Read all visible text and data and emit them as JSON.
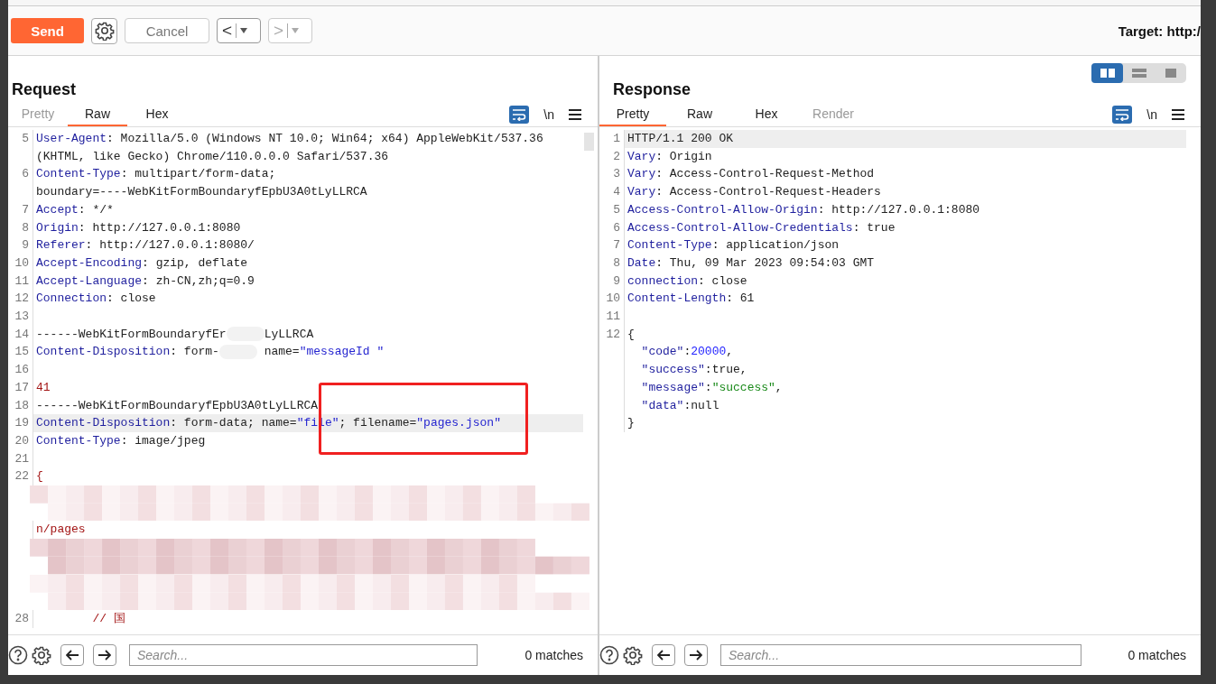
{
  "toolbar": {
    "send": "Send",
    "cancel": "Cancel",
    "back": "<",
    "forward": ">",
    "target": "Target: http:/"
  },
  "request": {
    "title": "Request",
    "tabs": [
      {
        "label": "Pretty",
        "selected": false,
        "disabled": true
      },
      {
        "label": "Raw",
        "selected": true,
        "disabled": false
      },
      {
        "label": "Hex",
        "selected": false,
        "disabled": false
      }
    ],
    "wrap_on": true,
    "newline_label": "\\n",
    "lines": [
      {
        "kind": "code",
        "number": "5",
        "highlighted": false,
        "rows": [
          {
            "parts": [
              {
                "kind": "key",
                "text": "User-Agent"
              },
              {
                "kind": "plain",
                "text": ": Mozilla/5.0 (Windows NT 10.0; Win64; x64) AppleWebKit/537.36"
              }
            ]
          },
          {
            "parts": [
              {
                "kind": "plain",
                "text": "(KHTML, like Gecko) Chrome/110.0.0.0 Safari/537.36"
              }
            ]
          }
        ]
      },
      {
        "kind": "code",
        "number": "6",
        "highlighted": false,
        "rows": [
          {
            "parts": [
              {
                "kind": "key",
                "text": "Content-Type"
              },
              {
                "kind": "plain",
                "text": ": multipart/form-data;"
              }
            ]
          },
          {
            "parts": [
              {
                "kind": "plain",
                "text": "boundary=----WebKitFormBoundaryfEpbU3A0tLyLLRCA"
              }
            ]
          }
        ]
      },
      {
        "kind": "code",
        "number": "7",
        "highlighted": false,
        "rows": [
          {
            "parts": [
              {
                "kind": "key",
                "text": "Accept"
              },
              {
                "kind": "plain",
                "text": ": */*"
              }
            ]
          }
        ]
      },
      {
        "kind": "code",
        "number": "8",
        "highlighted": false,
        "rows": [
          {
            "parts": [
              {
                "kind": "key",
                "text": "Origin"
              },
              {
                "kind": "plain",
                "text": ": http://127.0.0.1:8080"
              }
            ]
          }
        ]
      },
      {
        "kind": "code",
        "number": "9",
        "highlighted": false,
        "rows": [
          {
            "parts": [
              {
                "kind": "key",
                "text": "Referer"
              },
              {
                "kind": "plain",
                "text": ": http://127.0.0.1:8080/"
              }
            ]
          }
        ]
      },
      {
        "kind": "code",
        "number": "10",
        "highlighted": false,
        "rows": [
          {
            "parts": [
              {
                "kind": "key",
                "text": "Accept-Encoding"
              },
              {
                "kind": "plain",
                "text": ": gzip, deflate"
              }
            ]
          }
        ]
      },
      {
        "kind": "code",
        "number": "11",
        "highlighted": false,
        "rows": [
          {
            "parts": [
              {
                "kind": "key",
                "text": "Accept-Language"
              },
              {
                "kind": "plain",
                "text": ": zh-CN,zh;q=0.9"
              }
            ]
          }
        ]
      },
      {
        "kind": "code",
        "number": "12",
        "highlighted": false,
        "rows": [
          {
            "parts": [
              {
                "kind": "key",
                "text": "Connection"
              },
              {
                "kind": "plain",
                "text": ": close"
              }
            ]
          }
        ]
      },
      {
        "kind": "code",
        "number": "13",
        "highlighted": false,
        "rows": [
          {
            "parts": []
          }
        ]
      },
      {
        "kind": "code",
        "number": "14",
        "highlighted": false,
        "rows": [
          {
            "parts": [
              {
                "kind": "plain",
                "text": "------WebKitFormBoundaryfEr"
              },
              {
                "kind": "smudge"
              },
              {
                "kind": "plain",
                "text": "LyLLRCA"
              }
            ]
          }
        ]
      },
      {
        "kind": "code",
        "number": "15",
        "highlighted": false,
        "rows": [
          {
            "parts": [
              {
                "kind": "key",
                "text": "Content-Disposition"
              },
              {
                "kind": "plain",
                "text": ": form-"
              },
              {
                "kind": "smudge"
              },
              {
                "kind": "plain",
                "text": " name="
              },
              {
                "kind": "str",
                "text": "\"messageId \""
              }
            ]
          }
        ]
      },
      {
        "kind": "code",
        "number": "16",
        "highlighted": false,
        "rows": [
          {
            "parts": []
          }
        ]
      },
      {
        "kind": "code",
        "number": "17",
        "highlighted": false,
        "rows": [
          {
            "parts": [
              {
                "kind": "red",
                "text": "41"
              }
            ]
          }
        ]
      },
      {
        "kind": "code",
        "number": "18",
        "highlighted": false,
        "rows": [
          {
            "parts": [
              {
                "kind": "plain",
                "text": "------WebKitFormBoundaryfEpbU3A0tLyLLRCA"
              }
            ]
          }
        ]
      },
      {
        "kind": "code",
        "number": "19",
        "highlighted": true,
        "rows": [
          {
            "parts": [
              {
                "kind": "key",
                "text": "Content-Disposition"
              },
              {
                "kind": "plain",
                "text": ": form-data; name="
              },
              {
                "kind": "str",
                "text": "\"file\""
              },
              {
                "kind": "plain",
                "text": "; filename="
              },
              {
                "kind": "str",
                "text": "\"pages.json\""
              }
            ]
          }
        ]
      },
      {
        "kind": "code",
        "number": "20",
        "highlighted": false,
        "rows": [
          {
            "parts": [
              {
                "kind": "key",
                "text": "Content-Type"
              },
              {
                "kind": "plain",
                "text": ": image/jpeg"
              }
            ]
          }
        ]
      },
      {
        "kind": "code",
        "number": "21",
        "highlighted": false,
        "rows": [
          {
            "parts": []
          }
        ]
      },
      {
        "kind": "code",
        "number": "22",
        "highlighted": false,
        "rows": [
          {
            "parts": [
              {
                "kind": "red",
                "text": "{"
              }
            ]
          }
        ]
      },
      {
        "kind": "redacted"
      },
      {
        "kind": "code",
        "highlighted": false,
        "rows": [
          {
            "parts": [
              {
                "kind": "red",
                "text": "n/pages"
              }
            ]
          }
        ]
      },
      {
        "kind": "redacted"
      },
      {
        "kind": "redacted"
      },
      {
        "kind": "code",
        "number": "28",
        "highlighted": false,
        "rows": [
          {
            "parts": [
              {
                "kind": "red",
                "text": "        // 国"
              }
            ]
          }
        ]
      }
    ],
    "search": {
      "placeholder": "Search...",
      "matches": "0 matches"
    }
  },
  "response": {
    "title": "Response",
    "tabs": [
      {
        "label": "Pretty",
        "selected": true,
        "disabled": false
      },
      {
        "label": "Raw",
        "selected": false,
        "disabled": false
      },
      {
        "label": "Hex",
        "selected": false,
        "disabled": false
      },
      {
        "label": "Render",
        "selected": false,
        "disabled": true
      }
    ],
    "wrap_on": true,
    "newline_label": "\\n",
    "layout_buttons": [
      {
        "kind": "columns",
        "selected": true
      },
      {
        "kind": "rows",
        "selected": false
      },
      {
        "kind": "single",
        "selected": false
      }
    ],
    "lines": [
      {
        "kind": "code",
        "number": "1",
        "highlighted": true,
        "rows": [
          {
            "parts": [
              {
                "kind": "plain",
                "text": "HTTP/1.1 200 OK"
              }
            ]
          }
        ]
      },
      {
        "kind": "code",
        "number": "2",
        "highlighted": false,
        "rows": [
          {
            "parts": [
              {
                "kind": "key",
                "text": "Vary"
              },
              {
                "kind": "plain",
                "text": ": Origin"
              }
            ]
          }
        ]
      },
      {
        "kind": "code",
        "number": "3",
        "highlighted": false,
        "rows": [
          {
            "parts": [
              {
                "kind": "key",
                "text": "Vary"
              },
              {
                "kind": "plain",
                "text": ": Access-Control-Request-Method"
              }
            ]
          }
        ]
      },
      {
        "kind": "code",
        "number": "4",
        "highlighted": false,
        "rows": [
          {
            "parts": [
              {
                "kind": "key",
                "text": "Vary"
              },
              {
                "kind": "plain",
                "text": ": Access-Control-Request-Headers"
              }
            ]
          }
        ]
      },
      {
        "kind": "code",
        "number": "5",
        "highlighted": false,
        "rows": [
          {
            "parts": [
              {
                "kind": "key",
                "text": "Access-Control-Allow-Origin"
              },
              {
                "kind": "plain",
                "text": ": http://127.0.0.1:8080"
              }
            ]
          }
        ]
      },
      {
        "kind": "code",
        "number": "6",
        "highlighted": false,
        "rows": [
          {
            "parts": [
              {
                "kind": "key",
                "text": "Access-Control-Allow-Credentials"
              },
              {
                "kind": "plain",
                "text": ": true"
              }
            ]
          }
        ]
      },
      {
        "kind": "code",
        "number": "7",
        "highlighted": false,
        "rows": [
          {
            "parts": [
              {
                "kind": "key",
                "text": "Content-Type"
              },
              {
                "kind": "plain",
                "text": ": application/json"
              }
            ]
          }
        ]
      },
      {
        "kind": "code",
        "number": "8",
        "highlighted": false,
        "rows": [
          {
            "parts": [
              {
                "kind": "key",
                "text": "Date"
              },
              {
                "kind": "plain",
                "text": ": Thu, 09 Mar 2023 09:54:03 GMT"
              }
            ]
          }
        ]
      },
      {
        "kind": "code",
        "number": "9",
        "highlighted": false,
        "rows": [
          {
            "parts": [
              {
                "kind": "key",
                "text": "connection"
              },
              {
                "kind": "plain",
                "text": ": close"
              }
            ]
          }
        ]
      },
      {
        "kind": "code",
        "number": "10",
        "highlighted": false,
        "rows": [
          {
            "parts": [
              {
                "kind": "key",
                "text": "Content-Length"
              },
              {
                "kind": "plain",
                "text": ": 61"
              }
            ]
          }
        ]
      },
      {
        "kind": "code",
        "number": "11",
        "highlighted": false,
        "rows": [
          {
            "parts": []
          }
        ]
      },
      {
        "kind": "code",
        "number": "12",
        "highlighted": false,
        "rows": [
          {
            "parts": [
              {
                "kind": "plain",
                "text": "{"
              }
            ]
          },
          {
            "parts": [
              {
                "kind": "key",
                "text": "  \"code\""
              },
              {
                "kind": "plain",
                "text": ":"
              },
              {
                "kind": "num",
                "text": "20000"
              },
              {
                "kind": "plain",
                "text": ","
              }
            ]
          },
          {
            "parts": [
              {
                "kind": "key",
                "text": "  \"success\""
              },
              {
                "kind": "plain",
                "text": ":true,"
              }
            ]
          },
          {
            "parts": [
              {
                "kind": "key",
                "text": "  \"message\""
              },
              {
                "kind": "plain",
                "text": ":"
              },
              {
                "kind": "green",
                "text": "\"success\""
              },
              {
                "kind": "plain",
                "text": ","
              }
            ]
          },
          {
            "parts": [
              {
                "kind": "key",
                "text": "  \"data\""
              },
              {
                "kind": "plain",
                "text": ":null"
              }
            ]
          },
          {
            "parts": [
              {
                "kind": "plain",
                "text": "}"
              }
            ]
          }
        ]
      }
    ],
    "search": {
      "placeholder": "Search...",
      "matches": "0 matches"
    }
  }
}
